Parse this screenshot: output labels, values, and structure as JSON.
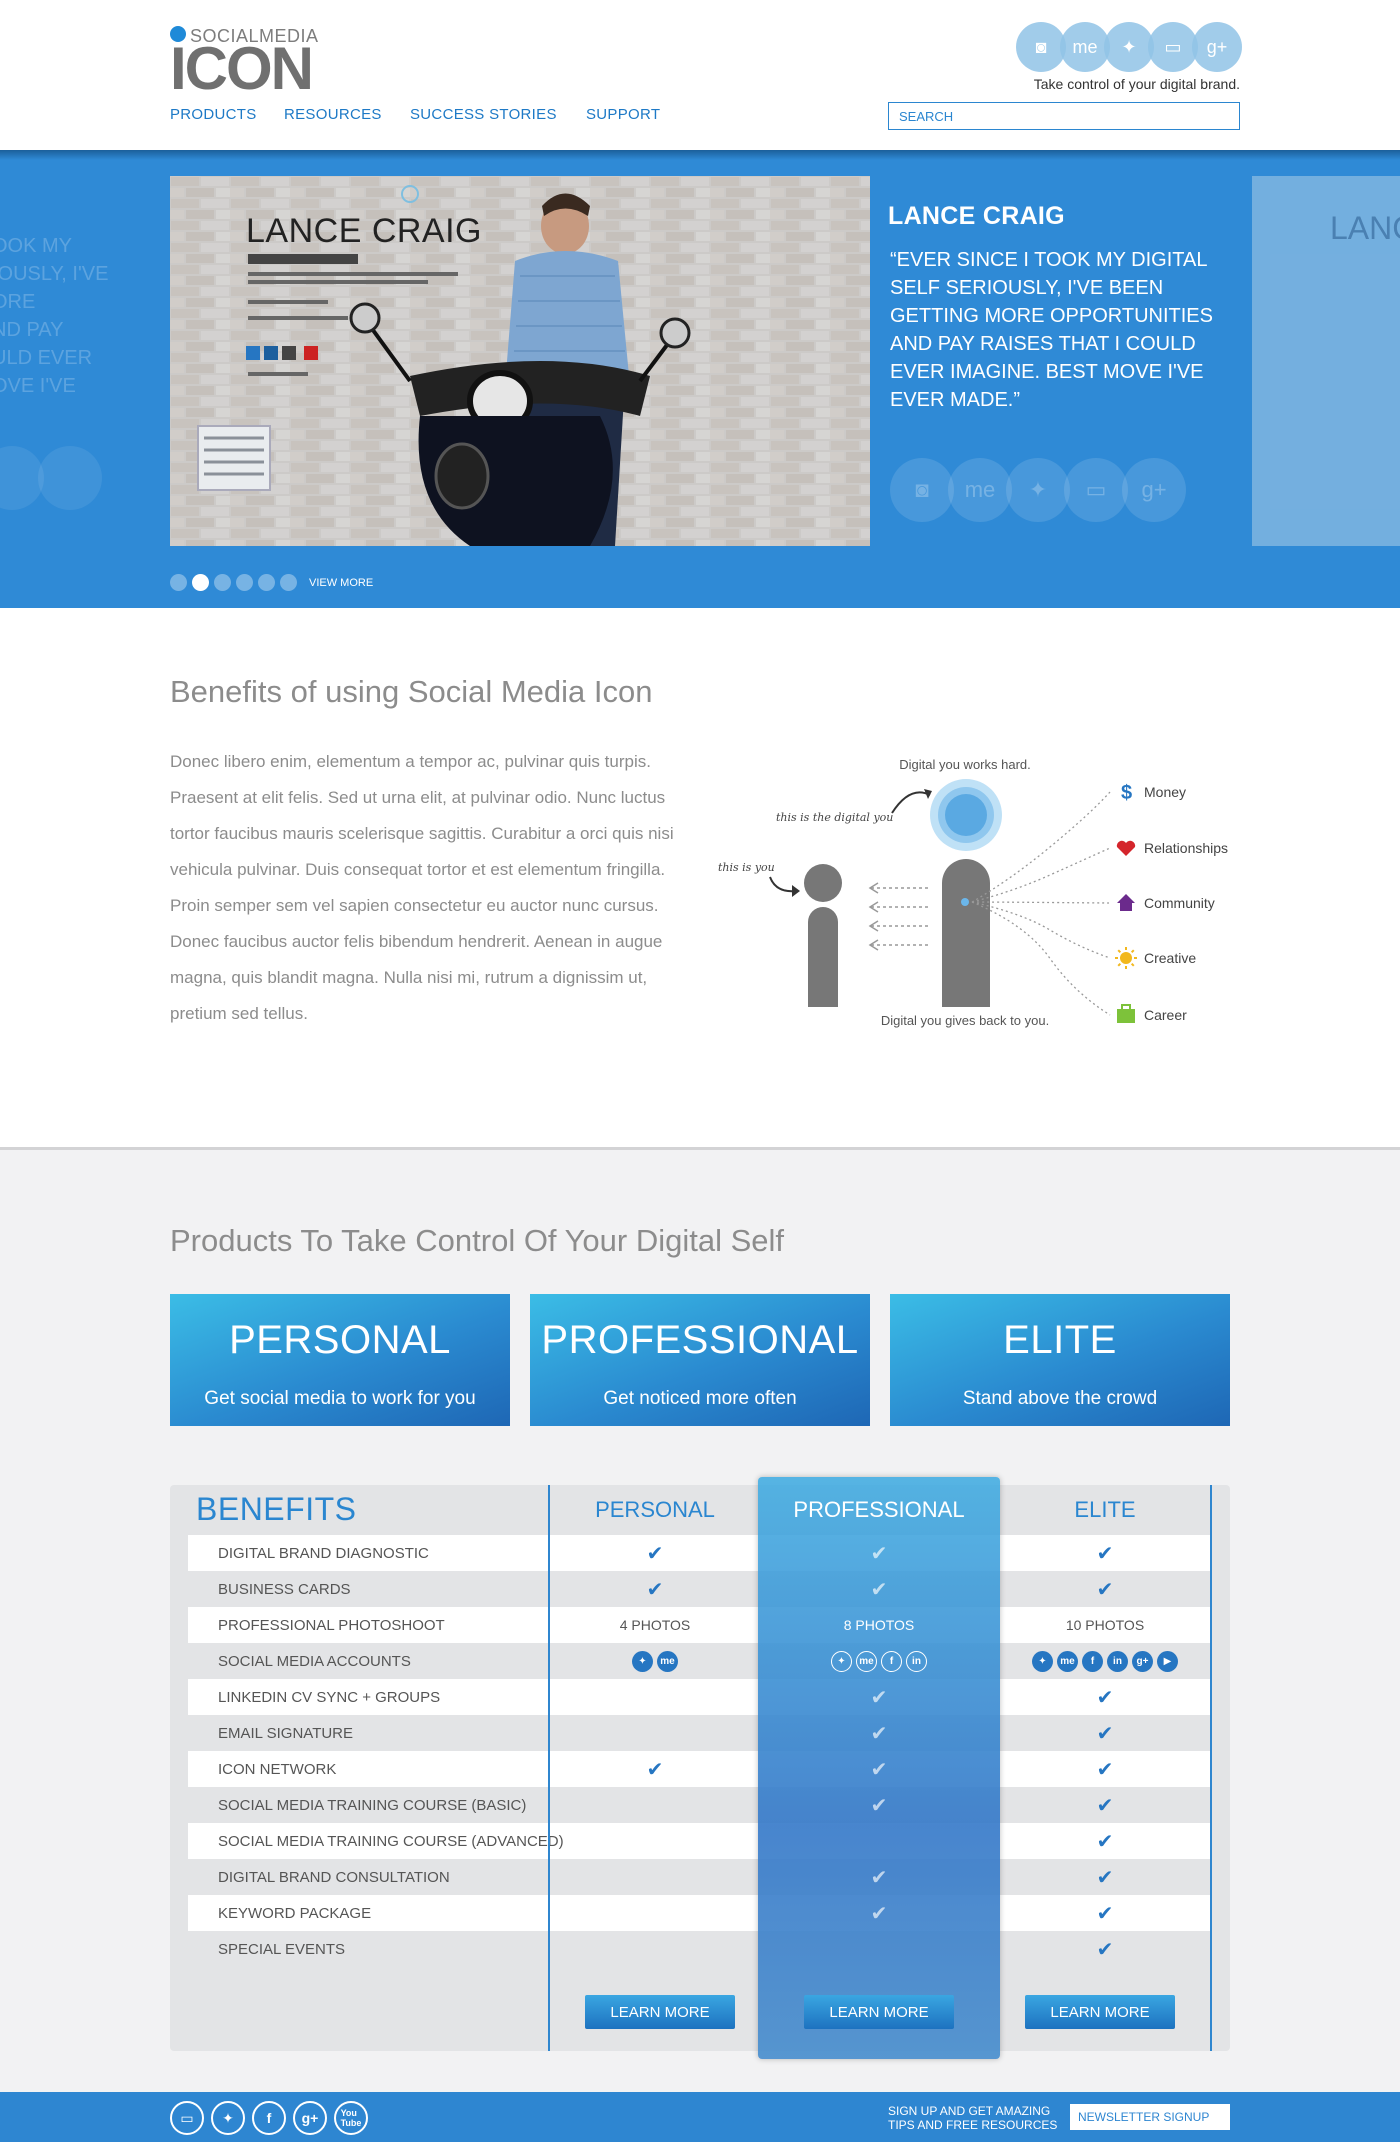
{
  "brand": {
    "small": "SOCIALMEDIA",
    "big": "ICON",
    "tagline": "Take control of your digital brand."
  },
  "header_social": [
    {
      "icon": "camera-icon",
      "glyph": "◙"
    },
    {
      "icon": "aboutme-icon",
      "glyph": "me"
    },
    {
      "icon": "twitter-icon",
      "glyph": "✦"
    },
    {
      "icon": "card-icon",
      "glyph": "▭"
    },
    {
      "icon": "googleplus-icon",
      "glyph": "g+"
    }
  ],
  "nav": {
    "products": "PRODUCTS",
    "resources": "RESOURCES",
    "success": "SUCCESS STORIES",
    "support": "SUPPORT"
  },
  "search": {
    "placeholder": "SEARCH"
  },
  "hero": {
    "ghost_text": "OOK MY\nIOUSLY, I'VE\nORE\nND PAY\nULD EVER\nOVE I'VE",
    "photo_name": "LANCE CRAIG",
    "name": "LANCE CRAIG",
    "quote": "“EVER SINCE I TOOK MY DIGITAL SELF SERIOUSLY, I'VE BEEN GETTING MORE OPPORTUNITIES AND PAY RAISES THAT I COULD EVER IMAGINE. BEST MOVE I'VE EVER MADE.”",
    "circles": [
      "◙",
      "me",
      "✦",
      "▭",
      "g+"
    ],
    "ghost_right_name": "LANC",
    "view_more": "VIEW MORE",
    "active_slide": 2,
    "slide_count": 6
  },
  "benefits": {
    "title": "Benefits of using Social Media Icon",
    "text": "Donec libero enim, elementum a tempor ac, pulvinar quis turpis. Praesent at elit felis. Sed ut urna elit, at pulvinar odio. Nunc luctus tortor faucibus mauris scelerisque sagittis. Curabitur a orci quis nisi vehicula pulvinar. Duis consequat tortor et est elementum fringilla. Proin semper sem vel sapien consectetur eu auctor nunc cursus. Donec faucibus auctor felis bibendum hendrerit. Aenean in augue magna, quis blandit magna. Nulla nisi mi, rutrum a dignissim ut, pretium sed tellus.",
    "diagram": {
      "top_label": "Digital you works hard.",
      "bottom_label": "Digital you gives back to you.",
      "digital_you": "this is the digital you",
      "this_is_you": "this is you",
      "items": [
        {
          "label": "Money",
          "icon": "dollar-icon",
          "color": "#2676c2"
        },
        {
          "label": "Relationships",
          "icon": "heart-icon",
          "color": "#d4252c"
        },
        {
          "label": "Community",
          "icon": "house-icon",
          "color": "#6b2a8c"
        },
        {
          "label": "Creative",
          "icon": "sun-icon",
          "color": "#f2b81e"
        },
        {
          "label": "Career",
          "icon": "briefcase-icon",
          "color": "#7dc23a"
        }
      ]
    }
  },
  "products": {
    "title": "Products To Take Control Of Your Digital Self",
    "cards": [
      {
        "title": "PERSONAL",
        "subtitle": "Get social media to work for you"
      },
      {
        "title": "PROFESSIONAL",
        "subtitle": "Get noticed more often"
      },
      {
        "title": "ELITE",
        "subtitle": "Stand above the crowd"
      }
    ]
  },
  "table": {
    "header": "BENEFITS",
    "columns": [
      "PERSONAL",
      "PROFESSIONAL",
      "ELITE"
    ],
    "rows": [
      {
        "label": "DIGITAL BRAND DIAGNOSTIC",
        "personal": "check",
        "professional": "check",
        "elite": "check"
      },
      {
        "label": "BUSINESS CARDS",
        "personal": "check",
        "professional": "check",
        "elite": "check"
      },
      {
        "label": "PROFESSIONAL PHOTOSHOOT",
        "personal": "4 PHOTOS",
        "professional": "8 PHOTOS",
        "elite": "10 PHOTOS"
      },
      {
        "label": "SOCIAL MEDIA ACCOUNTS",
        "personal": "icons:tw,me",
        "professional": "icons:tw,me,f,in",
        "elite": "icons:tw,me,f,in,g+,yt"
      },
      {
        "label": "LINKEDIN CV SYNC + GROUPS",
        "personal": "",
        "professional": "check",
        "elite": "check"
      },
      {
        "label": "EMAIL SIGNATURE",
        "personal": "",
        "professional": "check",
        "elite": "check"
      },
      {
        "label": "ICON NETWORK",
        "personal": "check",
        "professional": "check",
        "elite": "check"
      },
      {
        "label": "SOCIAL MEDIA TRAINING COURSE (BASIC)",
        "personal": "",
        "professional": "check",
        "elite": "check"
      },
      {
        "label": "SOCIAL MEDIA TRAINING COURSE (ADVANCED)",
        "personal": "",
        "professional": "",
        "elite": "check"
      },
      {
        "label": "DIGITAL BRAND CONSULTATION",
        "personal": "",
        "professional": "check",
        "elite": "check"
      },
      {
        "label": "KEYWORD PACKAGE",
        "personal": "",
        "professional": "check",
        "elite": "check"
      },
      {
        "label": "SPECIAL EVENTS",
        "personal": "",
        "professional": "",
        "elite": "check"
      }
    ],
    "learn_more": "LEARN MORE"
  },
  "footer": {
    "icons": [
      {
        "icon": "card-icon",
        "glyph": "▭"
      },
      {
        "icon": "twitter-icon",
        "glyph": "✦"
      },
      {
        "icon": "facebook-icon",
        "glyph": "f"
      },
      {
        "icon": "googleplus-icon",
        "glyph": "g+"
      },
      {
        "icon": "youtube-icon",
        "glyph": "You\nTube"
      }
    ],
    "signup_text": "SIGN UP AND GET AMAZING\nTIPS AND FREE RESOURCES",
    "newsletter": "NEWSLETTER SIGNUP"
  }
}
